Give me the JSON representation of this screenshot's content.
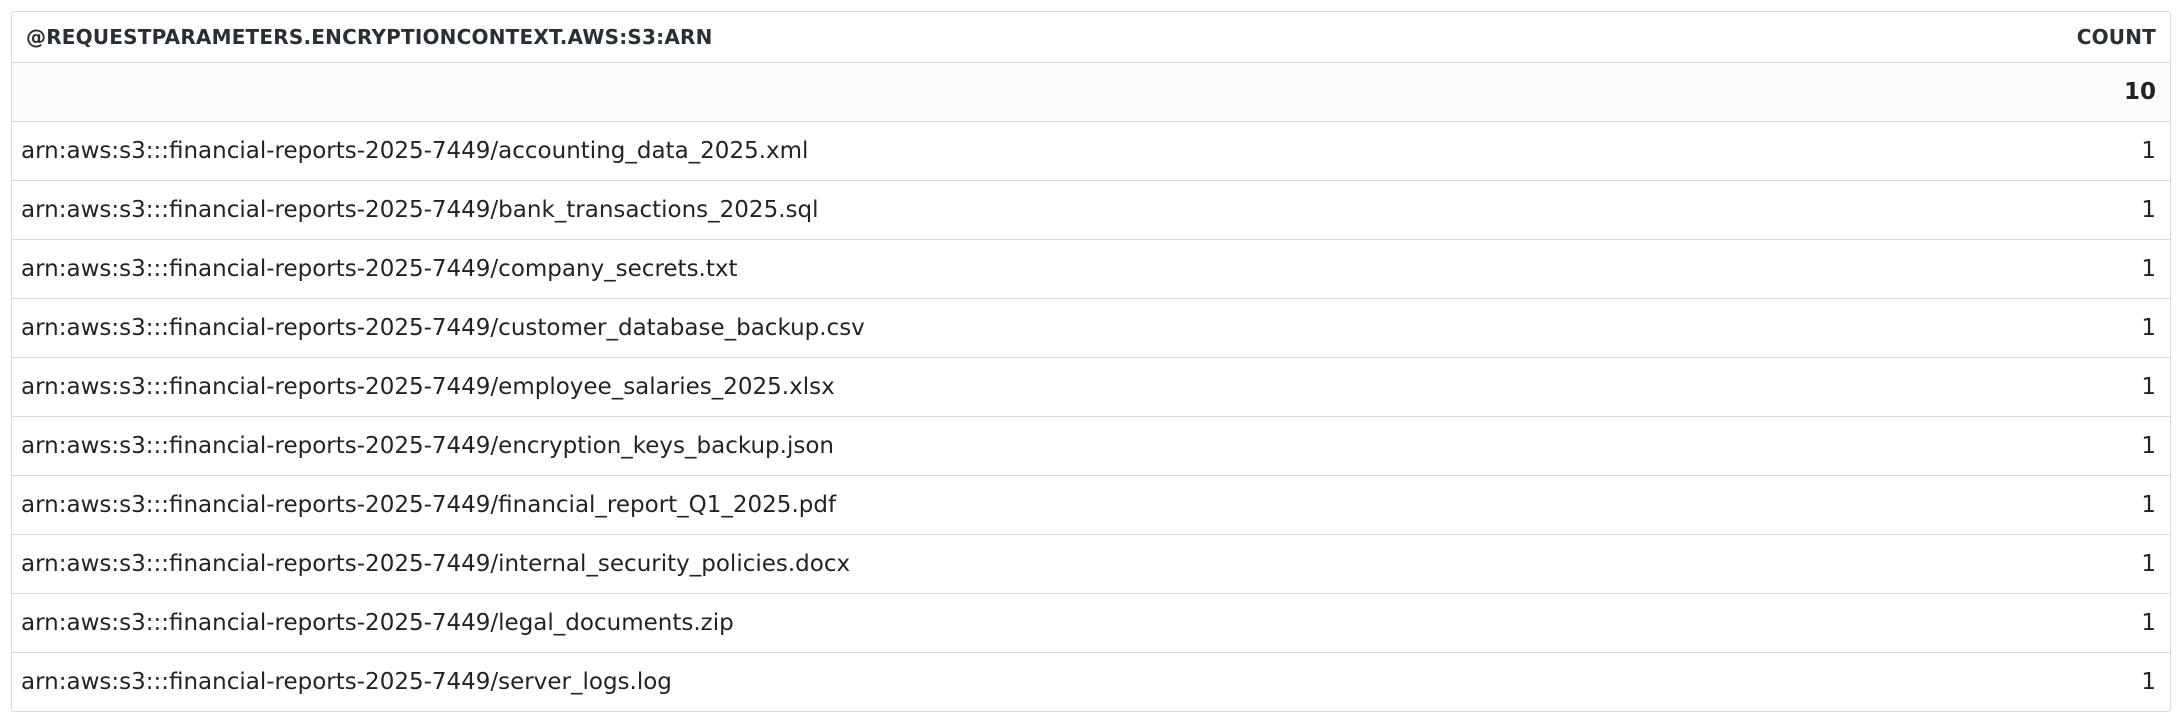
{
  "table": {
    "columns": {
      "arn": "@REQUESTPARAMETERS.ENCRYPTIONCONTEXT.AWS:S3:ARN",
      "count": "COUNT"
    },
    "total": {
      "arn": "",
      "count": "10"
    },
    "rows": [
      {
        "arn": "arn:aws:s3:::financial-reports-2025-7449/accounting_data_2025.xml",
        "count": "1"
      },
      {
        "arn": "arn:aws:s3:::financial-reports-2025-7449/bank_transactions_2025.sql",
        "count": "1"
      },
      {
        "arn": "arn:aws:s3:::financial-reports-2025-7449/company_secrets.txt",
        "count": "1"
      },
      {
        "arn": "arn:aws:s3:::financial-reports-2025-7449/customer_database_backup.csv",
        "count": "1"
      },
      {
        "arn": "arn:aws:s3:::financial-reports-2025-7449/employee_salaries_2025.xlsx",
        "count": "1"
      },
      {
        "arn": "arn:aws:s3:::financial-reports-2025-7449/encryption_keys_backup.json",
        "count": "1"
      },
      {
        "arn": "arn:aws:s3:::financial-reports-2025-7449/financial_report_Q1_2025.pdf",
        "count": "1"
      },
      {
        "arn": "arn:aws:s3:::financial-reports-2025-7449/internal_security_policies.docx",
        "count": "1"
      },
      {
        "arn": "arn:aws:s3:::financial-reports-2025-7449/legal_documents.zip",
        "count": "1"
      },
      {
        "arn": "arn:aws:s3:::financial-reports-2025-7449/server_logs.log",
        "count": "1"
      }
    ]
  }
}
